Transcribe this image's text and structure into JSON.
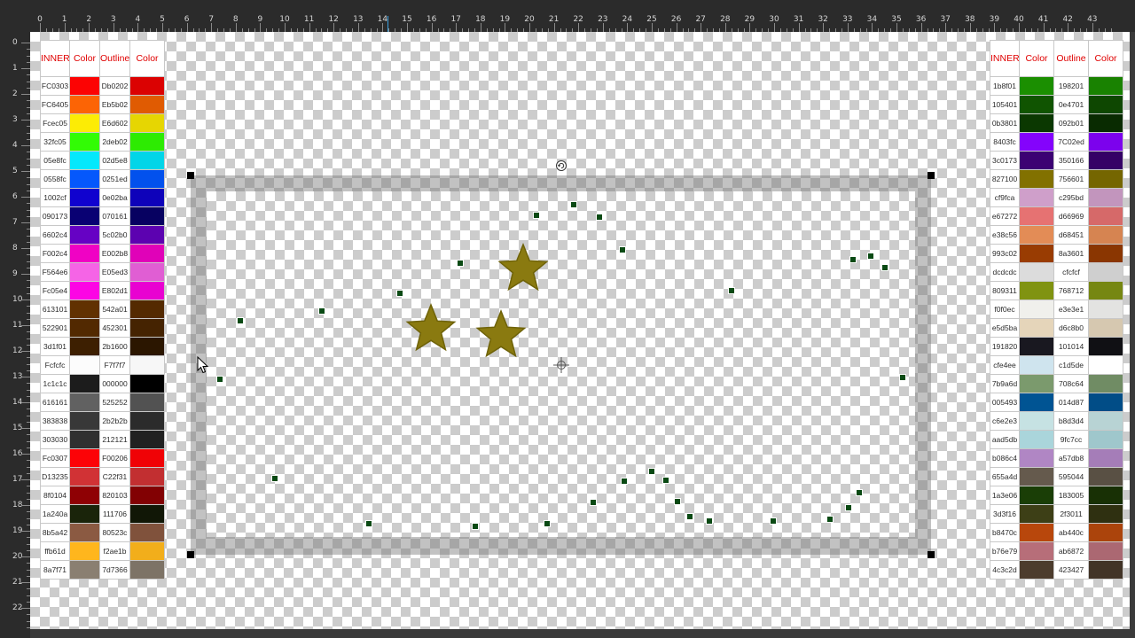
{
  "ruler": {
    "top_numbers": [
      "0",
      "1",
      "2",
      "3",
      "4",
      "5",
      "6",
      "7",
      "8",
      "9",
      "10",
      "11",
      "12",
      "13",
      "14",
      "15",
      "16",
      "17",
      "18",
      "19",
      "20",
      "21",
      "22",
      "23",
      "24",
      "25",
      "26",
      "27",
      "28",
      "29",
      "30",
      "31",
      "32",
      "33",
      "34",
      "35",
      "36",
      "37",
      "38",
      "39",
      "40",
      "41",
      "42",
      "43"
    ],
    "left_numbers": [
      "0",
      "1",
      "2",
      "3",
      "4",
      "5",
      "6",
      "7",
      "8",
      "9",
      "10",
      "11",
      "12",
      "13",
      "14",
      "15",
      "16",
      "17",
      "18",
      "19",
      "20",
      "21",
      "22"
    ]
  },
  "palette_left": {
    "headers": [
      "INNER",
      "Color",
      "Outline",
      "Color"
    ],
    "rows": [
      {
        "inner": "FC0303",
        "inner_color": "#fc0303",
        "outline": "Db0202",
        "outline_color": "#db0202"
      },
      {
        "inner": "FC6405",
        "inner_color": "#fc6405",
        "outline": "Eb5b02",
        "outline_color": "#e05b02"
      },
      {
        "inner": "Fcec05",
        "inner_color": "#fcec05",
        "outline": "E6d602",
        "outline_color": "#e6d602"
      },
      {
        "inner": "32fc05",
        "inner_color": "#32fc05",
        "outline": "2deb02",
        "outline_color": "#2deb02"
      },
      {
        "inner": "05e8fc",
        "inner_color": "#05e8fc",
        "outline": "02d5e8",
        "outline_color": "#02d5e8"
      },
      {
        "inner": "0558fc",
        "inner_color": "#0558fc",
        "outline": "0251ed",
        "outline_color": "#0251ed"
      },
      {
        "inner": "1002cf",
        "inner_color": "#1002cf",
        "outline": "0e02ba",
        "outline_color": "#0e02ba"
      },
      {
        "inner": "090173",
        "inner_color": "#090173",
        "outline": "070161",
        "outline_color": "#070161"
      },
      {
        "inner": "6602c4",
        "inner_color": "#6602c4",
        "outline": "5c02b0",
        "outline_color": "#5c02b0"
      },
      {
        "inner": "F002c4",
        "inner_color": "#f002c4",
        "outline": "E002b8",
        "outline_color": "#e002b8"
      },
      {
        "inner": "F564e6",
        "inner_color": "#f564e6",
        "outline": "E05ed3",
        "outline_color": "#e05ed3"
      },
      {
        "inner": "Fc05e4",
        "inner_color": "#fc05e4",
        "outline": "E802d1",
        "outline_color": "#e802d1"
      },
      {
        "inner": "613101",
        "inner_color": "#613101",
        "outline": "542a01",
        "outline_color": "#542a01"
      },
      {
        "inner": "522901",
        "inner_color": "#522901",
        "outline": "452301",
        "outline_color": "#452301"
      },
      {
        "inner": "3d1f01",
        "inner_color": "#3d1f01",
        "outline": "2b1600",
        "outline_color": "#2b1600"
      },
      {
        "inner": "Fcfcfc",
        "inner_color": "#fcfcfc",
        "outline": "F7f7f7",
        "outline_color": "#f7f7f7"
      },
      {
        "inner": "1c1c1c",
        "inner_color": "#1c1c1c",
        "outline": "000000",
        "outline_color": "#000000"
      },
      {
        "inner": "616161",
        "inner_color": "#616161",
        "outline": "525252",
        "outline_color": "#525252"
      },
      {
        "inner": "383838",
        "inner_color": "#383838",
        "outline": "2b2b2b",
        "outline_color": "#2b2b2b"
      },
      {
        "inner": "303030",
        "inner_color": "#303030",
        "outline": "212121",
        "outline_color": "#212121"
      },
      {
        "inner": "Fc0307",
        "inner_color": "#fc0307",
        "outline": "F00206",
        "outline_color": "#f00206"
      },
      {
        "inner": "D13235",
        "inner_color": "#d13235",
        "outline": "C22f31",
        "outline_color": "#c22f31"
      },
      {
        "inner": "8f0104",
        "inner_color": "#8f0104",
        "outline": "820103",
        "outline_color": "#820103"
      },
      {
        "inner": "1a240a",
        "inner_color": "#1a240a",
        "outline": "111706",
        "outline_color": "#111706"
      },
      {
        "inner": "8b5a42",
        "inner_color": "#8b5a42",
        "outline": "80523c",
        "outline_color": "#80523c"
      },
      {
        "inner": "ffb61d",
        "inner_color": "#ffb61d",
        "outline": "f2ae1b",
        "outline_color": "#f2ae1b"
      },
      {
        "inner": "8a7f71",
        "inner_color": "#8a7f71",
        "outline": "7d7366",
        "outline_color": "#7d7366"
      }
    ]
  },
  "palette_right": {
    "headers": [
      "INNER",
      "Color",
      "Outline",
      "Color"
    ],
    "rows": [
      {
        "inner": "1b8f01",
        "inner_color": "#1b8f01",
        "outline": "198201",
        "outline_color": "#198201"
      },
      {
        "inner": "105401",
        "inner_color": "#105401",
        "outline": "0e4701",
        "outline_color": "#0e4701"
      },
      {
        "inner": "0b3801",
        "inner_color": "#0b3801",
        "outline": "092b01",
        "outline_color": "#092b01"
      },
      {
        "inner": "8403fc",
        "inner_color": "#8403fc",
        "outline": "7C02ed",
        "outline_color": "#7c02ed"
      },
      {
        "inner": "3c0173",
        "inner_color": "#3c0173",
        "outline": "350166",
        "outline_color": "#350166"
      },
      {
        "inner": "827100",
        "inner_color": "#827100",
        "outline": "756601",
        "outline_color": "#756601"
      },
      {
        "inner": "cf9fca",
        "inner_color": "#cf9fca",
        "outline": "c295bd",
        "outline_color": "#c295bd"
      },
      {
        "inner": "e67272",
        "inner_color": "#e67272",
        "outline": "d66969",
        "outline_color": "#d66969"
      },
      {
        "inner": "e38c56",
        "inner_color": "#e38c56",
        "outline": "d68451",
        "outline_color": "#d68451"
      },
      {
        "inner": "993c02",
        "inner_color": "#993c02",
        "outline": "8a3601",
        "outline_color": "#8a3601"
      },
      {
        "inner": "dcdcdc",
        "inner_color": "#dcdcdc",
        "outline": "cfcfcf",
        "outline_color": "#cfcfcf"
      },
      {
        "inner": "809311",
        "inner_color": "#809311",
        "outline": "768712",
        "outline_color": "#768712"
      },
      {
        "inner": "f0f0ec",
        "inner_color": "#f0f0ec",
        "outline": "e3e3e1",
        "outline_color": "#e3e3e1"
      },
      {
        "inner": "e5d5ba",
        "inner_color": "#e5d5ba",
        "outline": "d6c8b0",
        "outline_color": "#d6c8b0"
      },
      {
        "inner": "191820",
        "inner_color": "#191820",
        "outline": "101014",
        "outline_color": "#101014"
      },
      {
        "inner": "cfe4ee",
        "inner_color": "#cfe4ee",
        "outline": "c1d5de",
        "outline_color": "#ffffff"
      },
      {
        "inner": "7b9a6d",
        "inner_color": "#7b9a6d",
        "outline": "708c64",
        "outline_color": "#708c64"
      },
      {
        "inner": "005493",
        "inner_color": "#005493",
        "outline": "014d87",
        "outline_color": "#014d87"
      },
      {
        "inner": "c6e2e3",
        "inner_color": "#c6e2e3",
        "outline": "b8d3d4",
        "outline_color": "#b8d3d4"
      },
      {
        "inner": "aad5db",
        "inner_color": "#aad5db",
        "outline": "9fc7cc",
        "outline_color": "#9fc7cc"
      },
      {
        "inner": "b086c4",
        "inner_color": "#b086c4",
        "outline": "a57db8",
        "outline_color": "#a57db8"
      },
      {
        "inner": "655a4d",
        "inner_color": "#655a4d",
        "outline": "595044",
        "outline_color": "#595044"
      },
      {
        "inner": "1a3e06",
        "inner_color": "#1a3e06",
        "outline": "183005",
        "outline_color": "#183005"
      },
      {
        "inner": "3d3f16",
        "inner_color": "#3d3f16",
        "outline": "2f3011",
        "outline_color": "#2f3011"
      },
      {
        "inner": "b8470c",
        "inner_color": "#b8470c",
        "outline": "ab440c",
        "outline_color": "#ab440c"
      },
      {
        "inner": "b76e79",
        "inner_color": "#b76e79",
        "outline": "ab6872",
        "outline_color": "#ab6872"
      },
      {
        "inner": "4c3c2d",
        "inner_color": "#4c3c2d",
        "outline": "423427",
        "outline_color": "#423427"
      }
    ]
  },
  "canvas": {
    "star_color": "#8a7a10",
    "star_outline_color": "#6e6208",
    "dot_color": "#0a4a14",
    "frame_color": "#8c8c8c"
  }
}
